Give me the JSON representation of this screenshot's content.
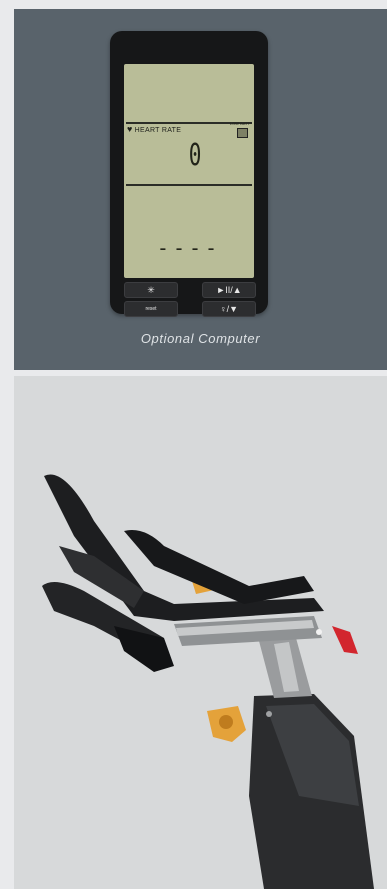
{
  "computer_display": {
    "heart_rate_label": "HEART RATE",
    "heart_icon": "heart-icon",
    "low_battery_label": "LOW BATT",
    "heart_rate_value": "0",
    "secondary_readout": "----",
    "buttons": {
      "light": "✳",
      "play_pause_up": "►II/▲",
      "reset": "reset",
      "hint_down": "♀/▼"
    }
  },
  "caption": "Optional Computer",
  "colors": {
    "top_panel": "#59636b",
    "bottom_panel": "#d7d9da",
    "lcd": "#b9bd98",
    "accent_orange": "#e4a23a",
    "accent_red": "#d2262e"
  },
  "illustration": "bike-handlebar-seat-assembly"
}
